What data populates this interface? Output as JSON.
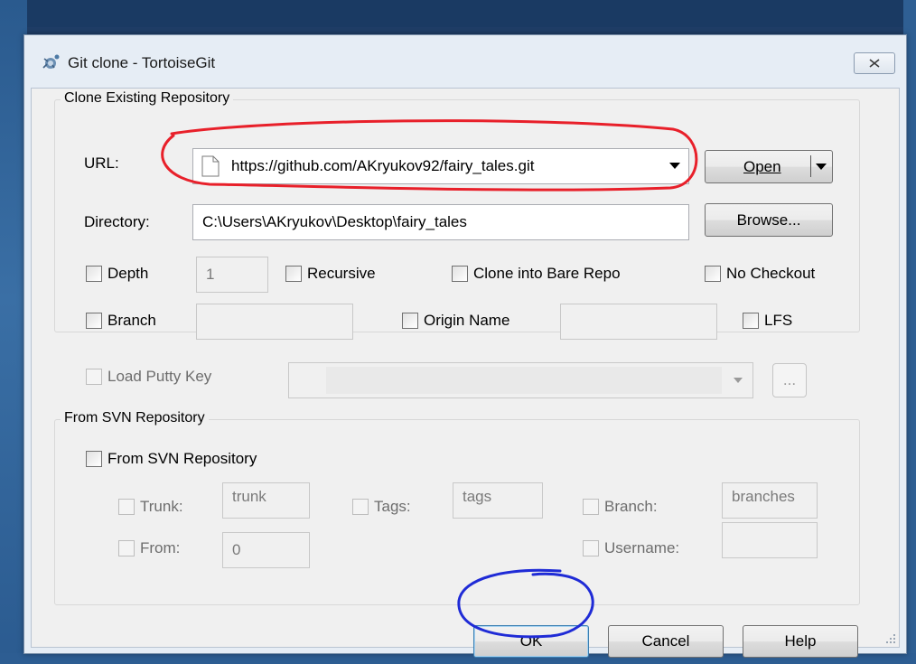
{
  "window": {
    "title": "Git clone - TortoiseGit"
  },
  "clone_group": {
    "title": "Clone Existing Repository",
    "url_label": "URL:",
    "url_value": "https://github.com/AKryukov92/fairy_tales.git",
    "open_button": "Open",
    "directory_label": "Directory:",
    "directory_value": "C:\\Users\\AKryukov\\Desktop\\fairy_tales",
    "browse_button": "Browse...",
    "depth_label": "Depth",
    "depth_value": "1",
    "recursive_label": "Recursive",
    "bare_repo_label": "Clone into Bare Repo",
    "no_checkout_label": "No Checkout",
    "branch_label": "Branch",
    "origin_name_label": "Origin Name",
    "lfs_label": "LFS"
  },
  "putty": {
    "load_key_label": "Load Putty Key",
    "browse_button": "..."
  },
  "svn_group": {
    "title": "From SVN Repository",
    "from_svn_label": "From SVN Repository",
    "trunk_label": "Trunk:",
    "trunk_value": "trunk",
    "tags_label": "Tags:",
    "tags_value": "tags",
    "branch_label": "Branch:",
    "branch_value": "branches",
    "from_label": "From:",
    "from_value": "0",
    "username_label": "Username:"
  },
  "buttons": {
    "ok": "OK",
    "cancel": "Cancel",
    "help": "Help"
  },
  "colors": {
    "annotation_red": "#e8202a",
    "annotation_blue": "#1f2bd6",
    "title_bar": "#e6edf5"
  }
}
